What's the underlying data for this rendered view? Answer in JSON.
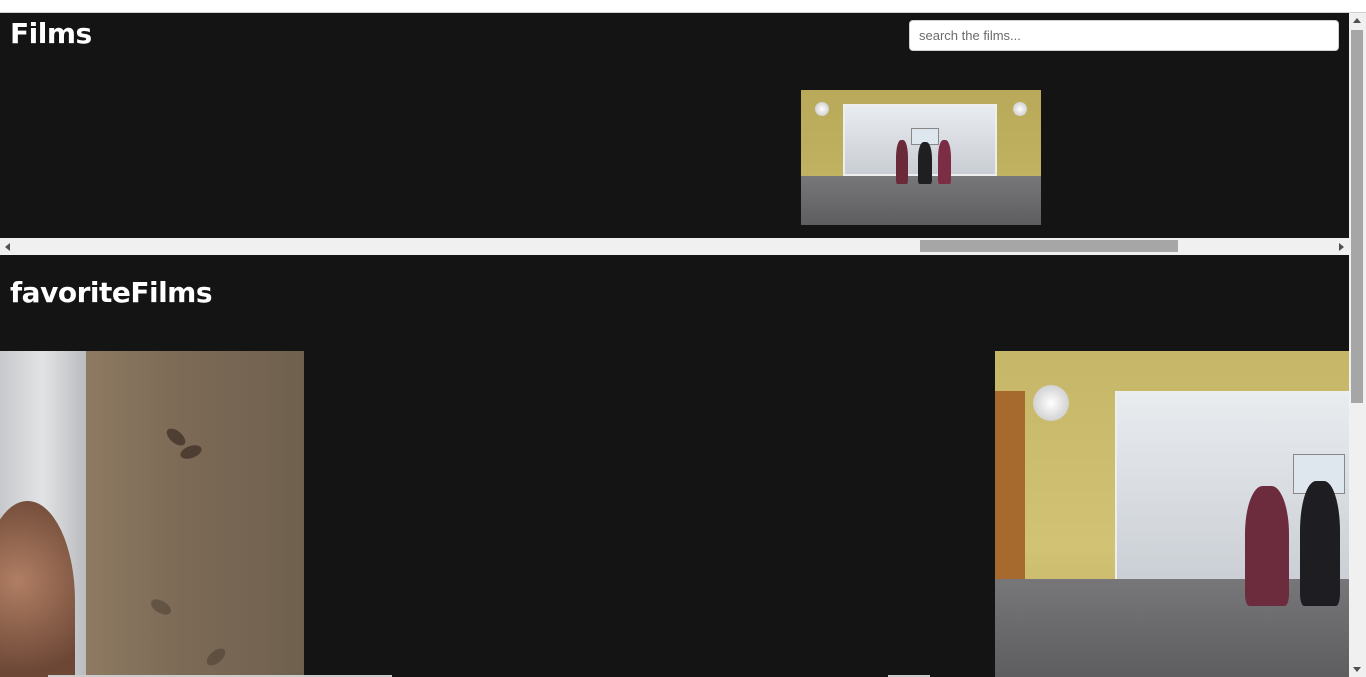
{
  "header": {
    "title": "Films",
    "search": {
      "placeholder": "search the films...",
      "value": ""
    }
  },
  "favorites": {
    "title": "favoriteFilms"
  },
  "icons": {
    "scroll_left": "scroll-left-arrow-icon",
    "scroll_right": "scroll-right-arrow-icon",
    "scroll_up": "scroll-up-arrow-icon",
    "scroll_down": "scroll-down-arrow-icon"
  },
  "colors": {
    "background": "#151415",
    "text": "#ffffff",
    "scrollbar_track": "#f0f0f0",
    "scrollbar_thumb": "#a6a6a6"
  }
}
